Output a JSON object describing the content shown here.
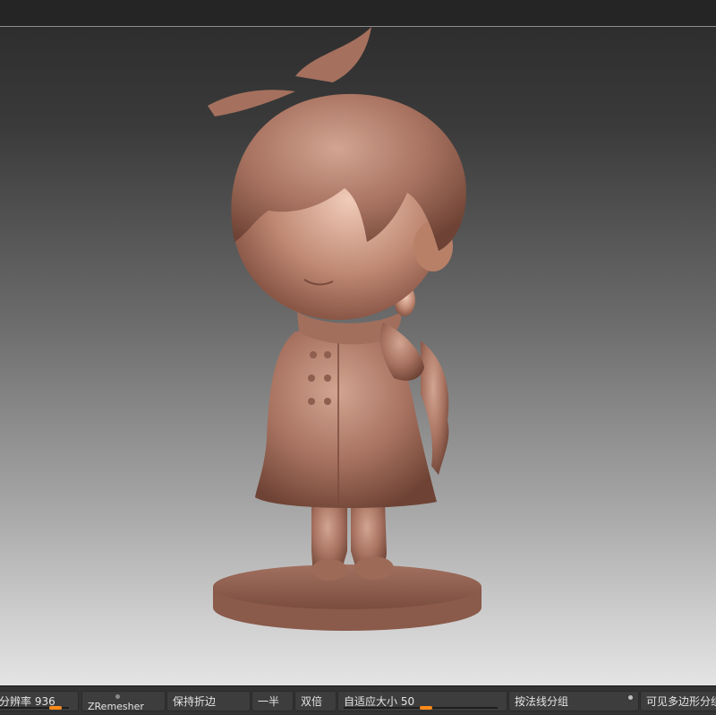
{
  "toolbar": {
    "resolution": {
      "label": "分辨率 936",
      "level": 0.08
    },
    "zremesher": {
      "label": "ZRemesher"
    },
    "keep_creases": {
      "label": "保持折边"
    },
    "half": {
      "label": "一半"
    },
    "double": {
      "label": "双倍"
    },
    "adaptive_size": {
      "label": "自适应大小 50",
      "level": 0.05
    },
    "group_by_normals": {
      "label": "按法线分组"
    },
    "visible_polygroups": {
      "label": "可见多边形分组"
    }
  },
  "colors": {
    "clay": "#b37c66",
    "accent": "#ff8a1a"
  }
}
